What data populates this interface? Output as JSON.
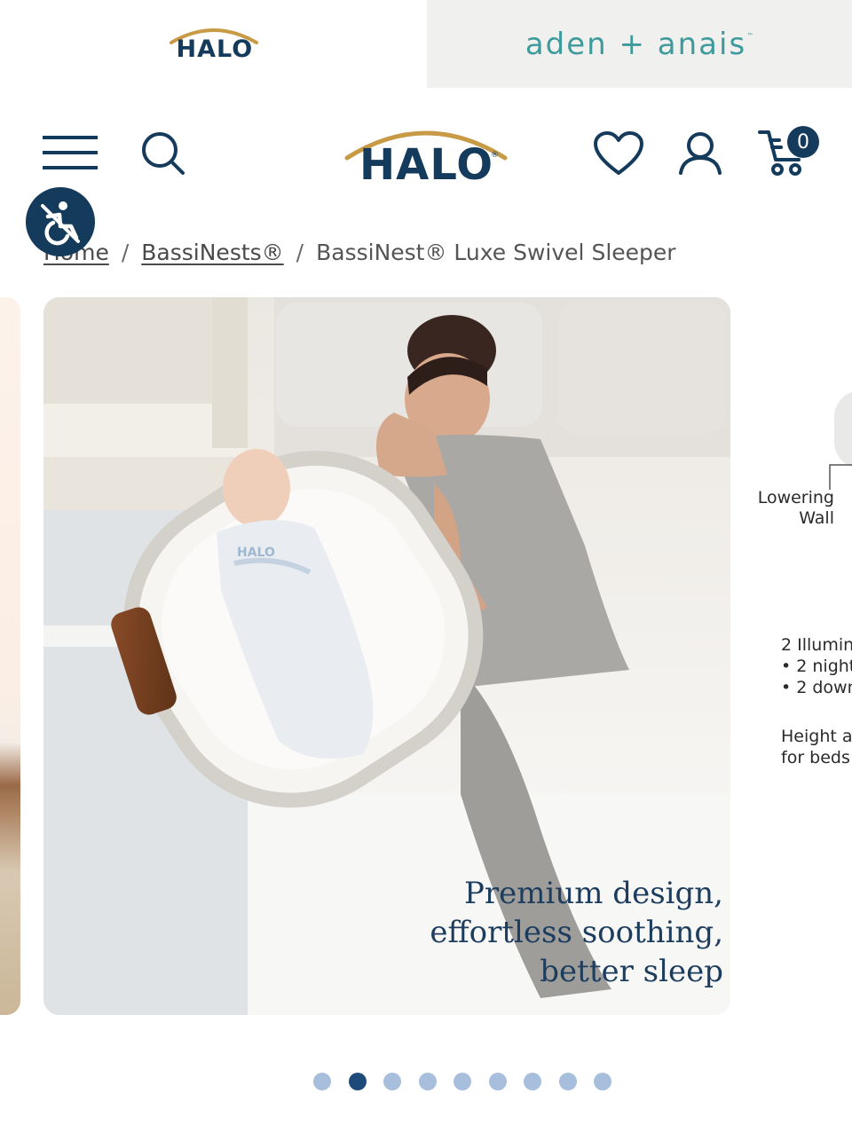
{
  "brand_switcher": {
    "halo": {
      "logo_text": "HALO"
    },
    "aden": {
      "logo_text": "aden + anais",
      "trademark": "™"
    }
  },
  "header": {
    "logo_text": "HALO",
    "registered_mark": "®",
    "cart_count": "0",
    "icons": [
      "menu-icon",
      "search-icon",
      "heart-icon",
      "account-icon",
      "cart-icon"
    ],
    "brand_color": "#143a5c",
    "accent_color": "#c89a45"
  },
  "breadcrumb": {
    "home": "Home",
    "category": "BassiNests®",
    "current": "BassiNest® Luxe Swivel Sleeper"
  },
  "carousel": {
    "active_slide": {
      "caption_lines": [
        "Premium design,",
        "effortless soothing,",
        "better sleep"
      ],
      "swaddle_text": "HALO"
    },
    "next_slide": {
      "lowering_wall": [
        "Lowering",
        "Wall"
      ],
      "illumination_title": "2 Illumin",
      "illumination_points": [
        "• 2 night",
        "• 2 down"
      ],
      "height_lines": [
        "Height a",
        "for beds"
      ]
    },
    "total_dots": 9,
    "active_dot": 2
  }
}
